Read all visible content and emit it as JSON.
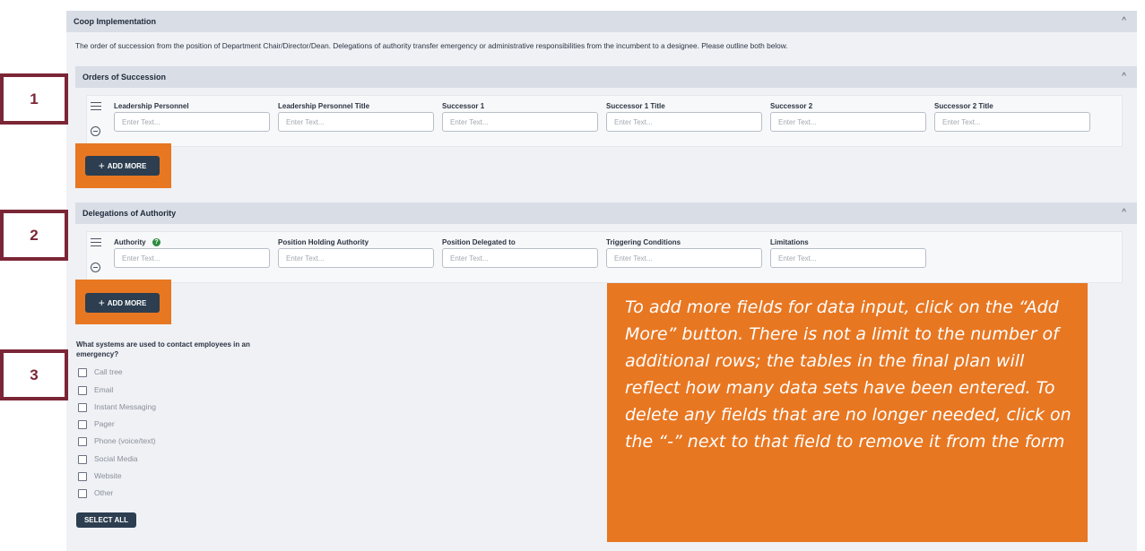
{
  "section": {
    "title": "Coop Implementation",
    "description": "The order of succession from the position of Department Chair/Director/Dean. Delegations of authority transfer emergency or administrative responsibilities from the incumbent to a designee. Please outline both below."
  },
  "orders_of_succession": {
    "title": "Orders of Succession",
    "fields": [
      {
        "label": "Leadership Personnel",
        "placeholder": "Enter Text..."
      },
      {
        "label": "Leadership Personnel Title",
        "placeholder": "Enter Text..."
      },
      {
        "label": "Successor 1",
        "placeholder": "Enter Text..."
      },
      {
        "label": "Successor 1 Title",
        "placeholder": "Enter Text..."
      },
      {
        "label": "Successor 2",
        "placeholder": "Enter Text..."
      },
      {
        "label": "Successor 2 Title",
        "placeholder": "Enter Text..."
      }
    ],
    "add_more_label": "ADD MORE"
  },
  "delegations_of_authority": {
    "title": "Delegations of Authority",
    "fields": [
      {
        "label": "Authority",
        "placeholder": "Enter Text..."
      },
      {
        "label": "Position Holding Authority",
        "placeholder": "Enter Text..."
      },
      {
        "label": "Position Delegated to",
        "placeholder": "Enter Text..."
      },
      {
        "label": "Triggering Conditions",
        "placeholder": "Enter Text..."
      },
      {
        "label": "Limitations",
        "placeholder": "Enter Text..."
      }
    ],
    "help_icon": "?",
    "add_more_label": "ADD MORE"
  },
  "contact_systems": {
    "question": "What systems are used to contact employees in an emergency?",
    "options": [
      "Call tree",
      "Email",
      "Instant Messaging",
      "Pager",
      "Phone (voice/text)",
      "Social Media",
      "Website",
      "Other"
    ],
    "select_all_label": "SELECT ALL"
  },
  "annotations": {
    "markers": [
      "1",
      "2",
      "3"
    ],
    "callout": "To add more fields for data input, click on the “Add More” button. There is not a limit to the number of additional rows; the tables in the final plan will reflect how many data sets have been entered. To delete any fields that are no longer needed, click on the “-” next to that field to remove it from the form"
  },
  "icons": {
    "chevron_up": "^",
    "plus": "+"
  },
  "colors": {
    "annotation_orange": "#e87722",
    "marker_maroon": "#7b2636",
    "button_navy": "#2c3e50",
    "header_bar": "#d9dde6"
  }
}
